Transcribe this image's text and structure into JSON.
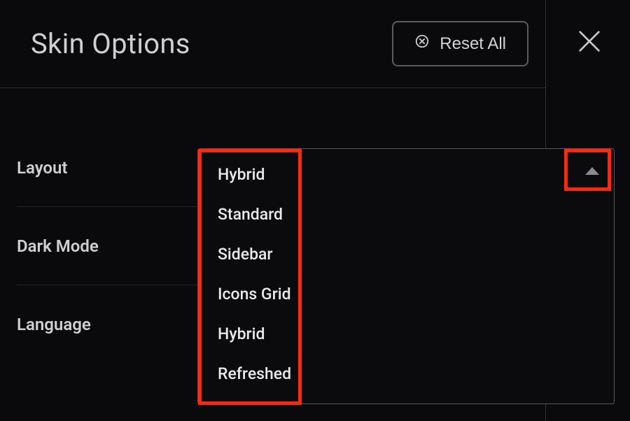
{
  "header": {
    "title": "Skin Options",
    "reset_label": "Reset All"
  },
  "settings": {
    "layout": {
      "label": "Layout"
    },
    "dark_mode": {
      "label": "Dark Mode"
    },
    "language": {
      "label": "Language"
    }
  },
  "dropdown": {
    "selected": "Hybrid",
    "options": [
      "Hybrid",
      "Standard",
      "Sidebar",
      "Icons Grid",
      "Hybrid",
      "Refreshed"
    ]
  }
}
